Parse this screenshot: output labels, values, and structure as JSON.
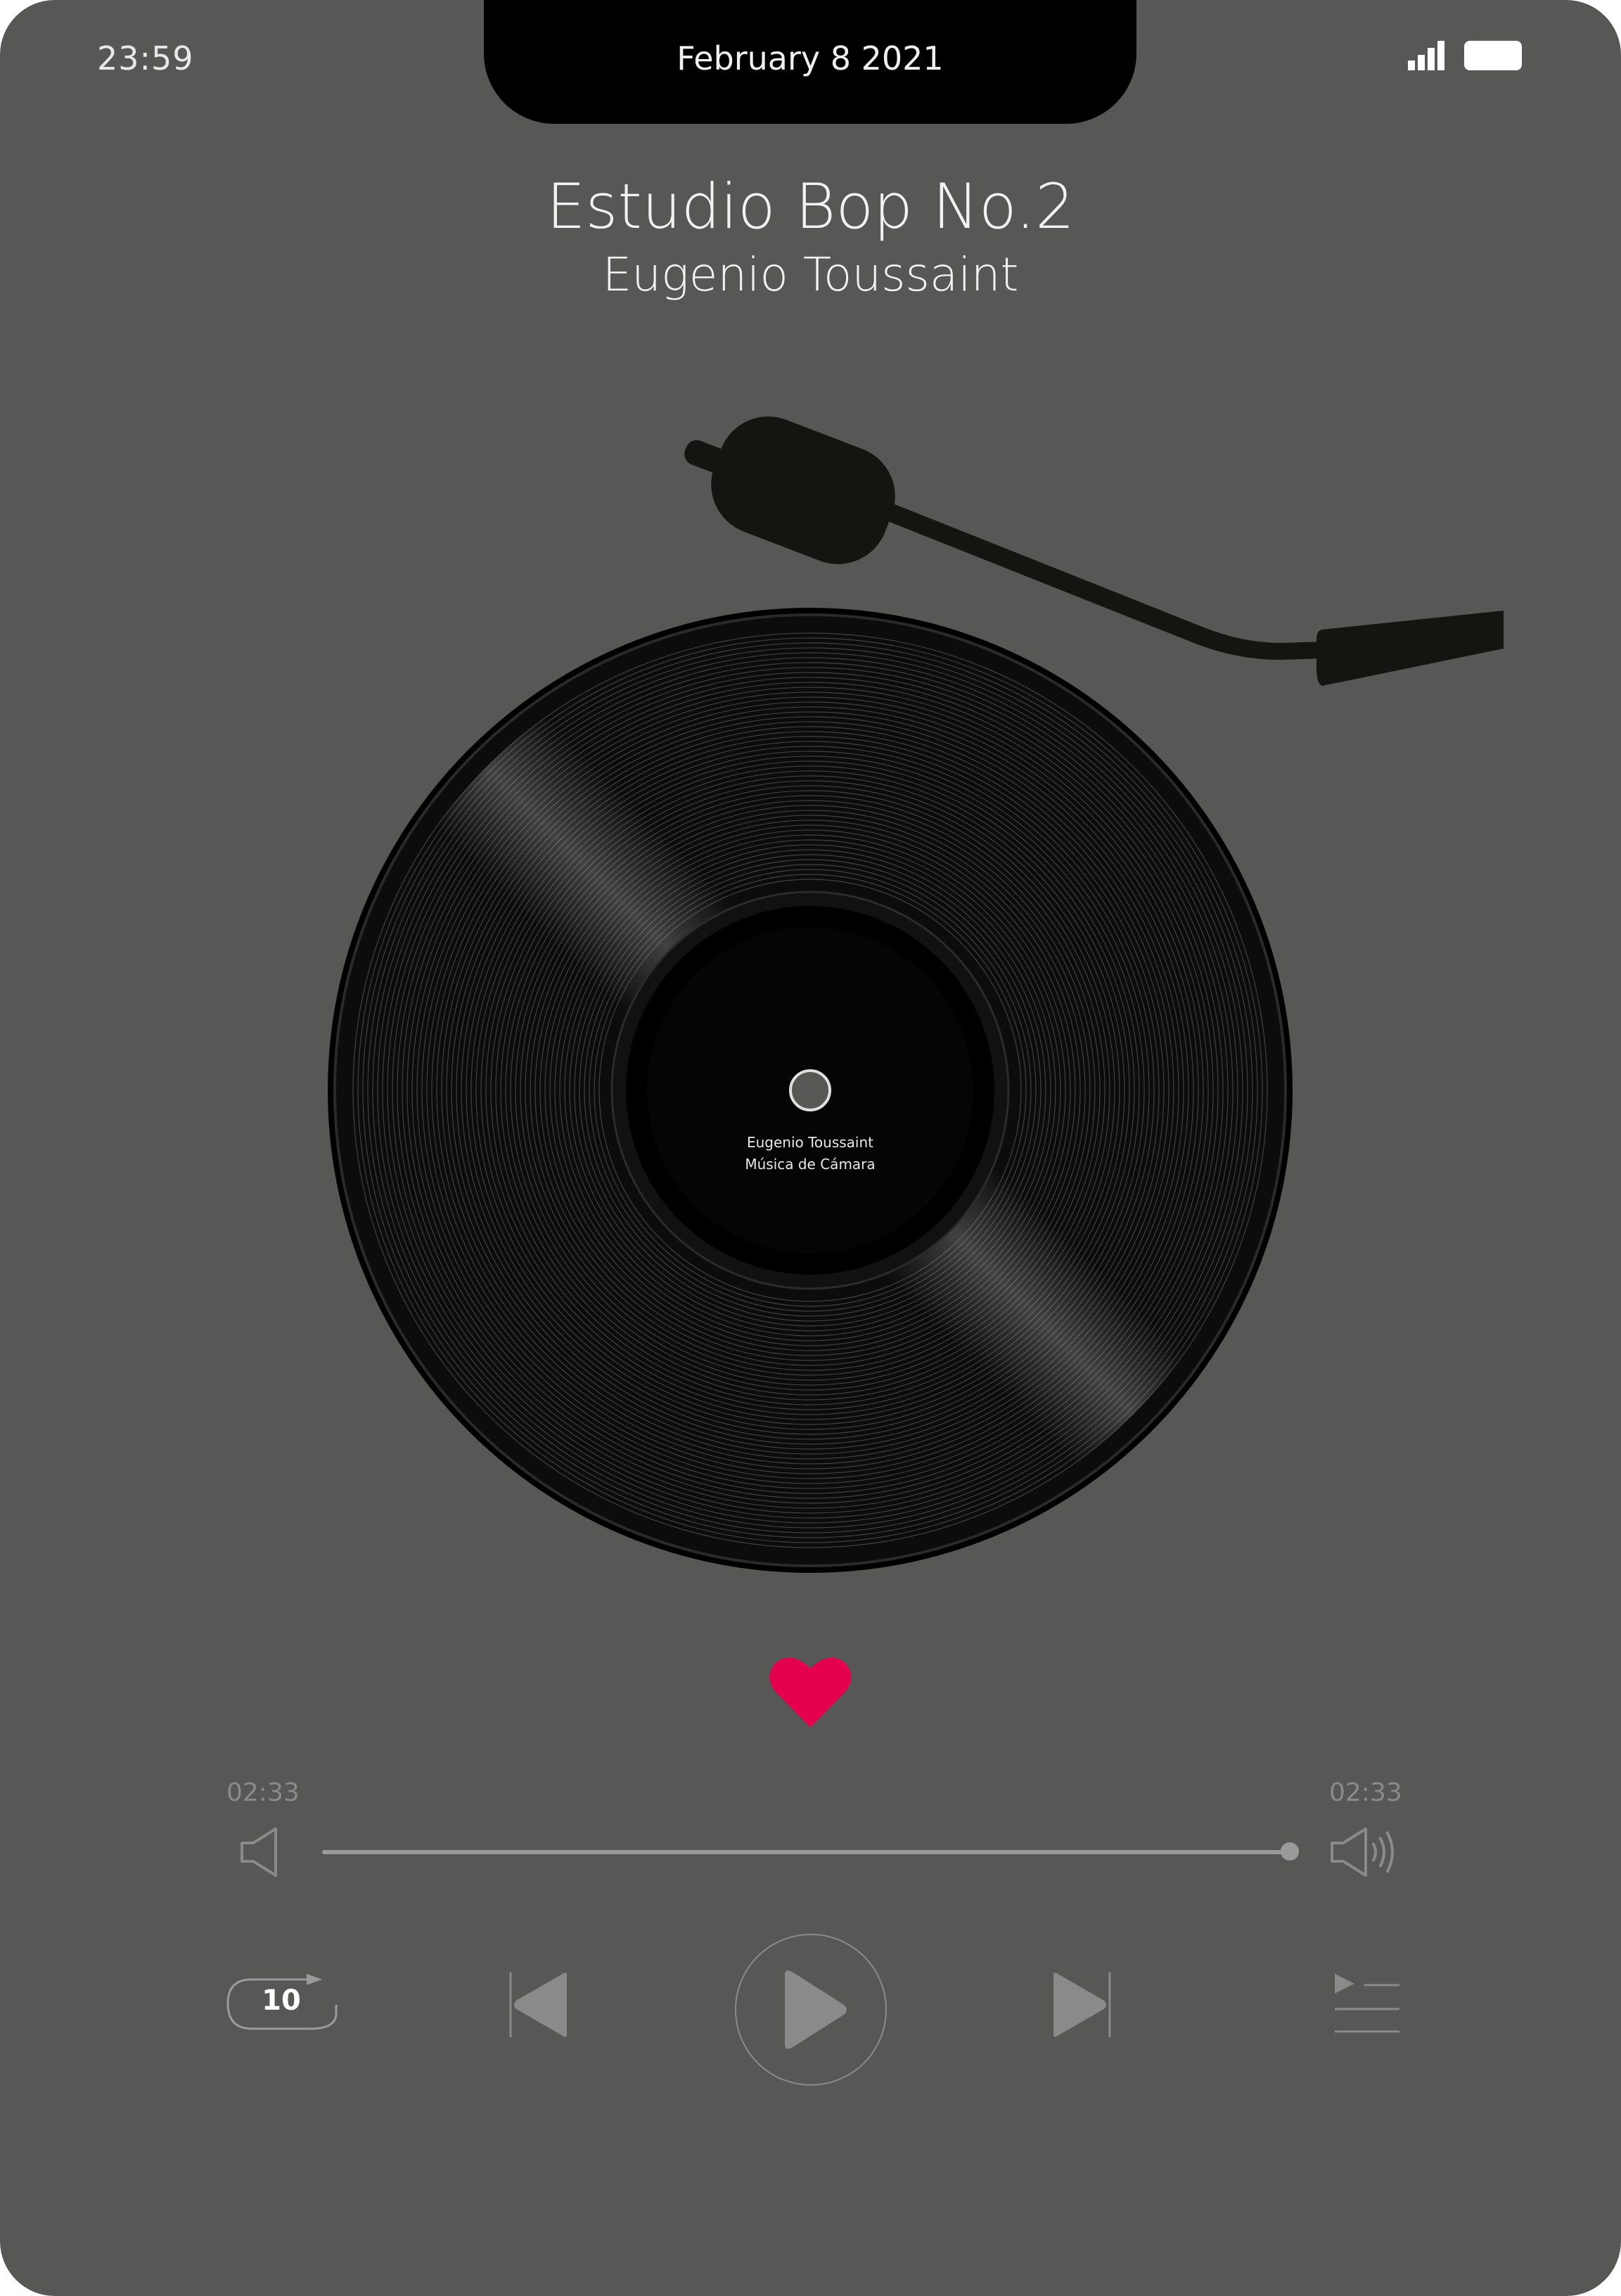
{
  "status_bar": {
    "time": "23:59",
    "date": "February 8  2021",
    "icons": [
      "signal-icon",
      "battery-icon"
    ]
  },
  "track": {
    "title": "Estudio Bop No.2",
    "artist": "Eugenio Toussaint"
  },
  "record_label": {
    "artist": "Eugenio Toussaint",
    "album": "Música de Cámara"
  },
  "favorite": {
    "icon": "heart-icon",
    "color": "#e5004d",
    "active": true
  },
  "playback": {
    "elapsed": "02:33",
    "total": "02:33",
    "progress_fraction": 1.0
  },
  "controls": {
    "replay_icon": "replay-10-icon",
    "replay_seconds": "10",
    "previous_icon": "previous-track-icon",
    "play_icon": "play-icon",
    "next_icon": "next-track-icon",
    "queue_icon": "queue-list-icon",
    "volume_low_icon": "volume-low-icon",
    "volume_high_icon": "volume-high-icon"
  },
  "colors": {
    "background": "#575756",
    "notch": "#000000",
    "tonearm": "#141410",
    "control_gray": "#8a8a8a",
    "accent": "#e5004d"
  }
}
